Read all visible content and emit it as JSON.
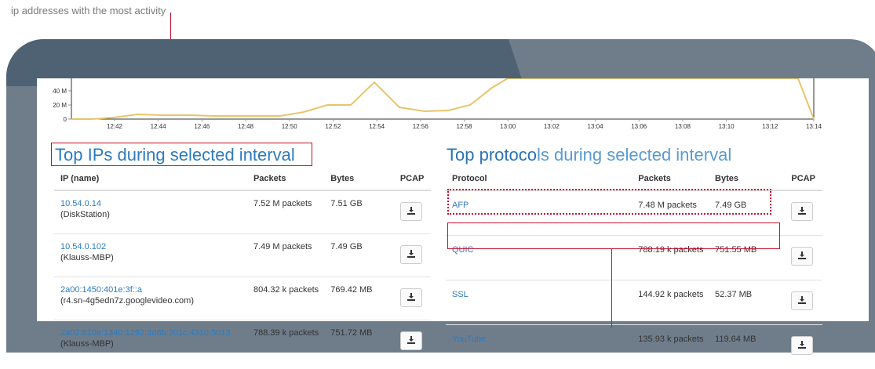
{
  "caption": "ip addresses with the most activity",
  "chart": {
    "y_labels": [
      "40 M",
      "20 M",
      "0"
    ],
    "x_labels": [
      "12:42",
      "12:44",
      "12:46",
      "12:48",
      "12:50",
      "12:52",
      "12:54",
      "12:56",
      "12:58",
      "13:00",
      "13:02",
      "13:04",
      "13:06",
      "13:08",
      "13:10",
      "13:12",
      "13:14"
    ],
    "line_color": "#e8c56a"
  },
  "top_ips": {
    "title": "Top IPs during selected interval",
    "headers": [
      "IP (name)",
      "Packets",
      "Bytes",
      "PCAP"
    ],
    "rows": [
      {
        "ip": "10.54.0.14",
        "name": "(DiskStation)",
        "packets": "7.52 M packets",
        "bytes": "7.51 GB"
      },
      {
        "ip": "10.54.0.102",
        "name": "(Klauss-MBP)",
        "packets": "7.49 M packets",
        "bytes": "7.49 GB"
      },
      {
        "ip": "2a00:1450:401e:3f::a",
        "name": "(r4.sn-4g5edn7z.googlevideo.com)",
        "packets": "804.32 k packets",
        "bytes": "769.42 MB"
      },
      {
        "ip": "2a02:810a:1340:1292:3d8b:201c:4310:5013",
        "name": "(Klauss-MBP)",
        "packets": "788.39 k packets",
        "bytes": "751.72 MB"
      }
    ]
  },
  "top_protocols": {
    "title_dark": "Top protoco",
    "title_light": "ls during selected interval",
    "headers": [
      "Protocol",
      "Packets",
      "Bytes",
      "PCAP"
    ],
    "rows": [
      {
        "protocol": "AFP",
        "packets": "7.48 M packets",
        "bytes": "7.49 GB"
      },
      {
        "protocol": "QUIC",
        "packets": "788.19 k packets",
        "bytes": "751.55 MB"
      },
      {
        "protocol": "SSL",
        "packets": "144.92 k packets",
        "bytes": "52.37 MB"
      },
      {
        "protocol": "YouTube",
        "packets": "135.93 k packets",
        "bytes": "119.64 MB"
      }
    ]
  },
  "colors": {
    "accent": "#2e7bbf",
    "highlight": "#c8102e"
  },
  "icons": {
    "download": "download-icon"
  }
}
